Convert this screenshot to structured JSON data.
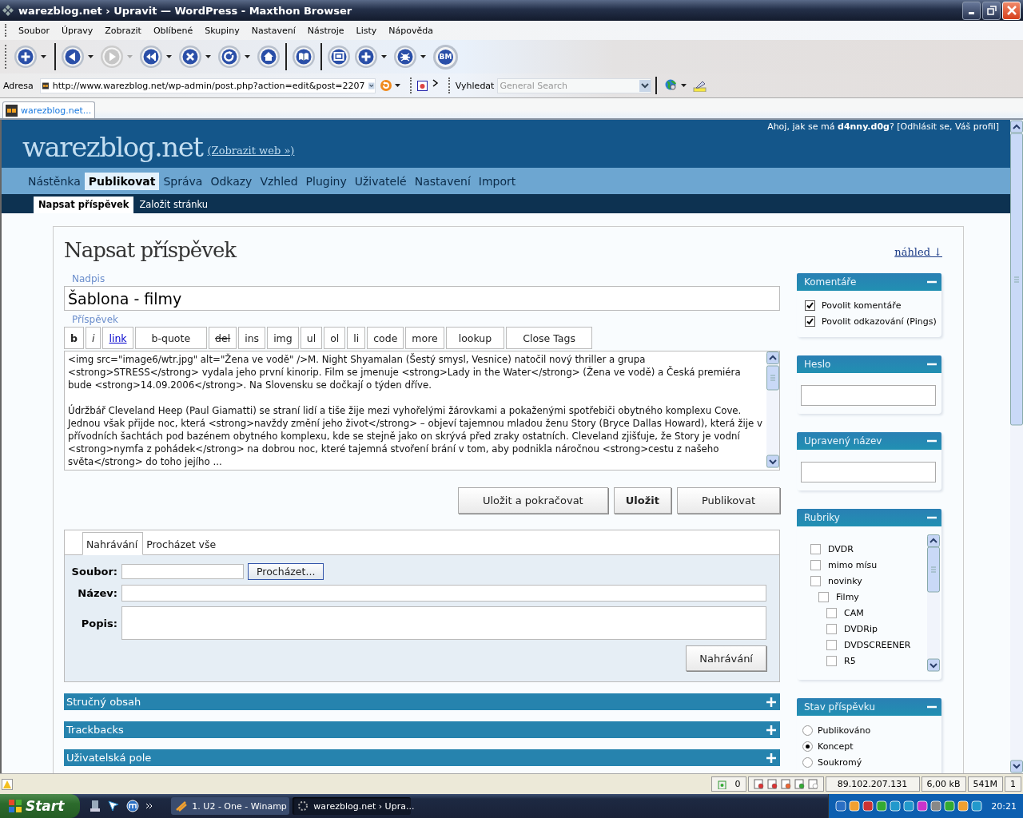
{
  "window": {
    "title": "warezblog.net › Upravit — WordPress - Maxthon Browser"
  },
  "menu": [
    "Soubor",
    "Úpravy",
    "Zobrazit",
    "Oblíbené",
    "Skupiny",
    "Nastavení",
    "Nástroje",
    "Listy",
    "Nápověda"
  ],
  "toolbar": [
    {
      "kind": "new",
      "disabled": false,
      "dropdown": true
    },
    {
      "kind": "back",
      "disabled": false,
      "dropdown": true
    },
    {
      "kind": "forward",
      "disabled": true,
      "dropdown": true
    },
    {
      "kind": "skip",
      "disabled": false,
      "dropdown": true
    },
    {
      "kind": "stop",
      "disabled": false,
      "dropdown": true
    },
    {
      "kind": "refresh",
      "disabled": false,
      "dropdown": true
    },
    {
      "kind": "home",
      "disabled": false,
      "dropdown": false
    },
    {
      "kind": "book",
      "disabled": false,
      "dropdown": false
    },
    {
      "kind": "screen",
      "disabled": false,
      "dropdown": false
    },
    {
      "kind": "add",
      "disabled": false,
      "dropdown": true
    },
    {
      "kind": "bug",
      "disabled": false,
      "dropdown": true
    },
    {
      "kind": "bm",
      "disabled": false,
      "dropdown": false,
      "label": "BM"
    }
  ],
  "address": {
    "label": "Adresa",
    "url": "http://www.warezblog.net/wp-admin/post.php?action=edit&post=2207"
  },
  "search": {
    "label": "Vyhledat",
    "placeholder": "General Search"
  },
  "tabs": [
    {
      "label": "warezblog.net...",
      "selected": true
    }
  ],
  "site": {
    "title": "warezblog.net",
    "view_link": "(Zobrazit web »)",
    "greeting": "Ahoj, jak se má **d4nny.d0g**? [Odhlásit se, Váš profil]"
  },
  "nav": [
    {
      "label": "Nástěnka",
      "selected": false
    },
    {
      "label": "Publikovat",
      "selected": true
    },
    {
      "label": "Správa",
      "selected": false
    },
    {
      "label": "Odkazy",
      "selected": false
    },
    {
      "label": "Vzhled",
      "selected": false
    },
    {
      "label": "Pluginy",
      "selected": false
    },
    {
      "label": "Uživatelé",
      "selected": false
    },
    {
      "label": "Nastavení",
      "selected": false
    },
    {
      "label": "Import",
      "selected": false
    }
  ],
  "subnav": [
    {
      "label": "Napsat příspěvek",
      "selected": true
    },
    {
      "label": "Založit stránku",
      "selected": false
    }
  ],
  "page_title": "Napsat příspěvek",
  "preview_link": "náhled ↓",
  "title_field": {
    "label": "Nadpis",
    "value": "Šablona - filmy"
  },
  "post": {
    "label": "Příspěvek",
    "quicktags": [
      {
        "label": "b",
        "kind": "bold"
      },
      {
        "label": "i",
        "kind": "italic"
      },
      {
        "label": "link",
        "kind": "link"
      },
      {
        "label": "b-quote",
        "kind": "plain"
      },
      {
        "label": "del",
        "kind": "strike"
      },
      {
        "label": "ins",
        "kind": "plain"
      },
      {
        "label": "img",
        "kind": "plain"
      },
      {
        "label": "ul",
        "kind": "plain"
      },
      {
        "label": "ol",
        "kind": "plain"
      },
      {
        "label": "li",
        "kind": "plain"
      },
      {
        "label": "code",
        "kind": "plain"
      },
      {
        "label": "more",
        "kind": "plain"
      },
      {
        "label": "lookup",
        "kind": "plain"
      },
      {
        "label": "Close Tags",
        "kind": "plain"
      }
    ],
    "content": "<img src=\"image6/wtr.jpg\" alt=\"Žena ve vodě\" />M. Night Shyamalan (Šestý smysl, Vesnice) natočil nový thriller a grupa <strong>STRESS</strong> vydala jeho první kinorip. Film se jmenuje <strong>Lady in the Water</strong> (Žena ve vodě) a Česká premiéra bude <strong>14.09.2006</strong>. Na Slovensku se dočkají o týden dříve.\n\nÚdržbář Cleveland Heep (Paul Giamatti) se straní lidí a tiše žije mezi vyhořelými žárovkami a pokaženými spotřebiči obytného komplexu Cove. Jednou však přijde noc, která <strong>navždy změní jeho život</strong> – objeví tajemnou mladou ženu Story (Bryce Dallas Howard), která žije v přívodních šachtách pod bazénem obytného komplexu, kde se stejně jako on skrývá před zraky ostatních. Cleveland zjišťuje, že Story je vodní <strong>nymfa z pohádek</strong> na dobrou noc, které tajemná stvoření brání v tom, aby podnikla náročnou <strong>cestu z našeho světa</strong> do toho jejího ..."
  },
  "actions": [
    {
      "label": "Uložit a pokračovat",
      "primary": false
    },
    {
      "label": "Uložit",
      "primary": true
    },
    {
      "label": "Publikovat",
      "primary": false
    }
  ],
  "upload": {
    "tabs": [
      {
        "label": "Nahrávání",
        "selected": true
      },
      {
        "label": "Procházet vše",
        "selected": false
      }
    ],
    "file_label": "Soubor:",
    "browse_button": "Procházet...",
    "name_label": "Název:",
    "description_label": "Popis:",
    "submit": "Nahrávání"
  },
  "panels": [
    {
      "title": "Stručný obsah",
      "expanded": false
    },
    {
      "title": "Trackbacks",
      "expanded": false
    },
    {
      "title": "Uživatelská pole",
      "expanded": false
    }
  ],
  "sidebar": [
    {
      "title": "Komentáře",
      "kind": "checkboxes",
      "expanded": true,
      "items": [
        {
          "label": "Povolit komentáře",
          "checked": true
        },
        {
          "label": "Povolit odkazování (Pings)",
          "checked": true
        }
      ]
    },
    {
      "title": "Heslo",
      "kind": "field",
      "expanded": true
    },
    {
      "title": "Upravený název",
      "kind": "field",
      "expanded": true
    },
    {
      "title": "Rubriky",
      "kind": "tree",
      "expanded": true,
      "items": [
        {
          "label": "DVDR",
          "checked": false
        },
        {
          "label": "mimo mísu",
          "checked": false
        },
        {
          "label": "novinky",
          "checked": false,
          "children": [
            {
              "label": "Filmy",
              "checked": false,
              "children": [
                {
                  "label": "CAM",
                  "checked": false
                },
                {
                  "label": "DVDRip",
                  "checked": false
                },
                {
                  "label": "DVDSCREENER",
                  "checked": false
                },
                {
                  "label": "R5",
                  "checked": false
                }
              ]
            }
          ]
        }
      ]
    },
    {
      "title": "Stav příspěvku",
      "kind": "radios",
      "expanded": true,
      "items": [
        {
          "label": "Publikováno",
          "selected": false
        },
        {
          "label": "Koncept",
          "selected": true
        },
        {
          "label": "Soukromý",
          "selected": false
        }
      ]
    }
  ],
  "status_bar": {
    "count": "0",
    "ip": "89.102.207.131",
    "size": "6,00 kB",
    "memory": "541M",
    "number": "1"
  },
  "taskbar": {
    "start": "Start",
    "tasks": [
      {
        "label": "1. U2 - One - Winamp",
        "selected": false
      },
      {
        "label": "warezblog.net › Upra...",
        "selected": true
      }
    ],
    "clock": "20:21"
  }
}
